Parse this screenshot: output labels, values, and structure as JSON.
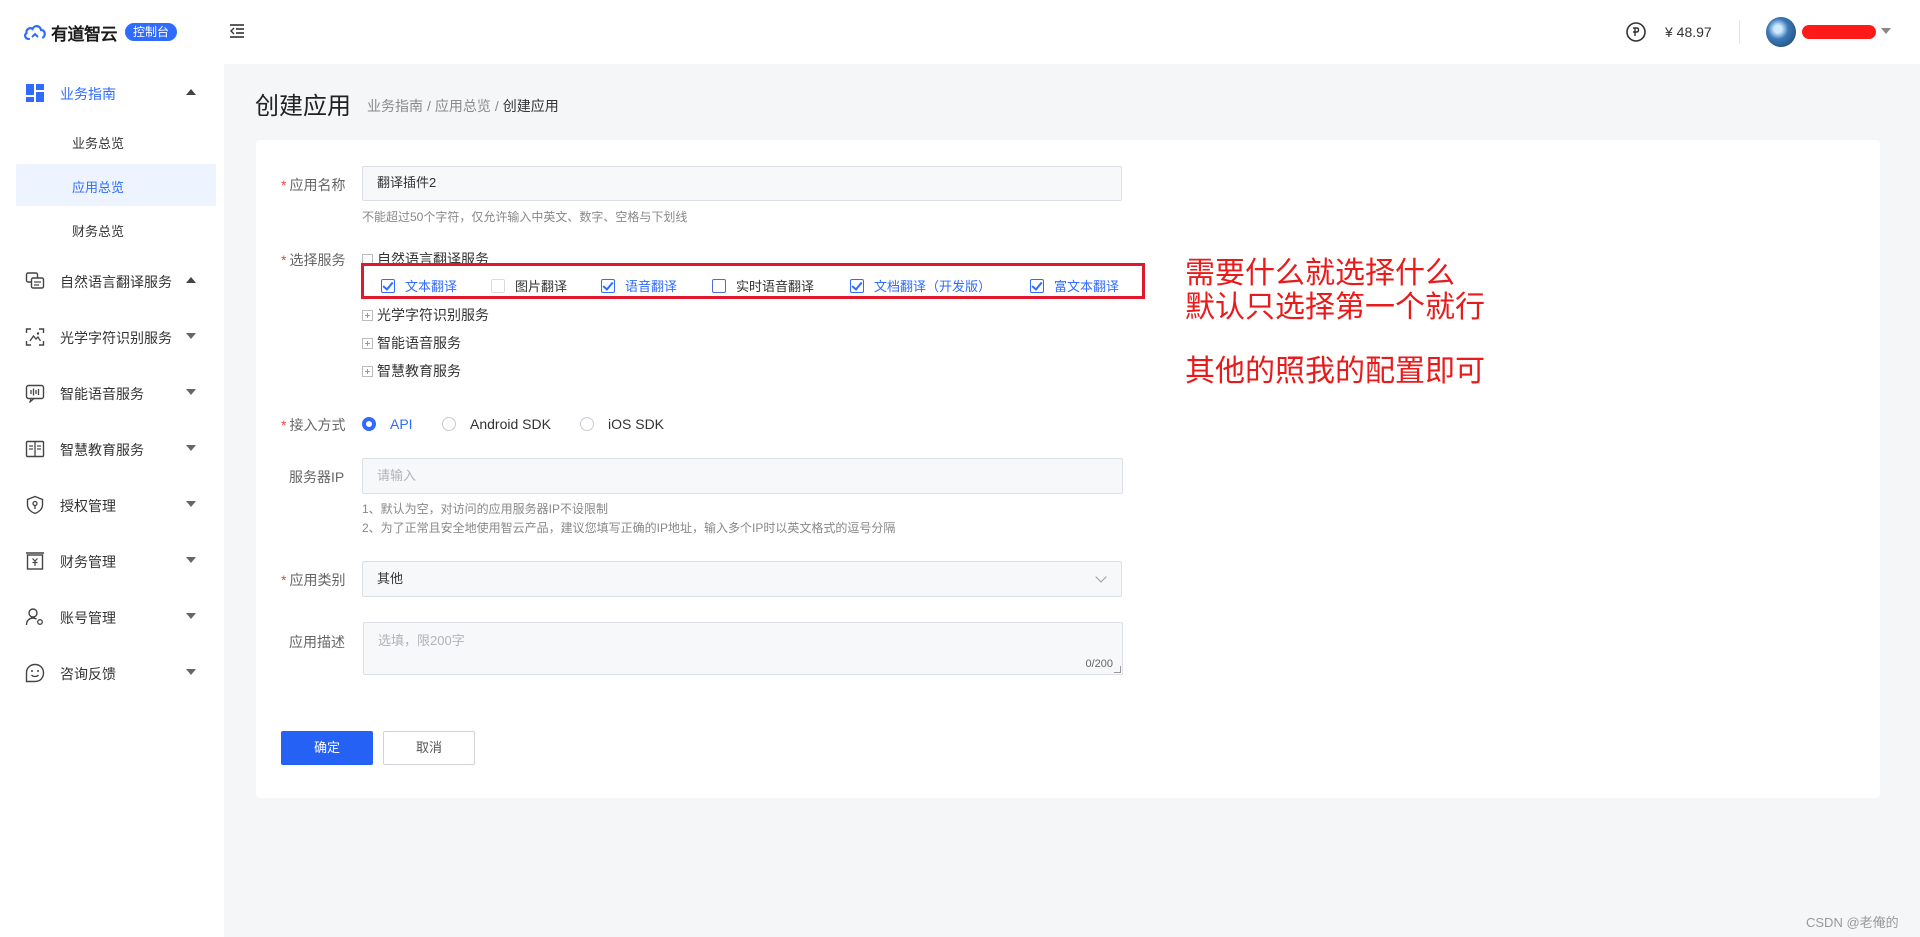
{
  "header": {
    "logo_text": "有道智云",
    "logo_badge": "控制台",
    "balance": "¥ 48.97"
  },
  "sidebar": {
    "groups": [
      {
        "label": "业务指南",
        "icon": "dashboard-icon",
        "expanded": true
      },
      {
        "label": "自然语言翻译服务",
        "icon": "translate-chat-icon",
        "expanded": true
      },
      {
        "label": "光学字符识别服务",
        "icon": "ocr-scan-icon",
        "expanded": false
      },
      {
        "label": "智能语音服务",
        "icon": "voice-wave-icon",
        "expanded": false
      },
      {
        "label": "智慧教育服务",
        "icon": "book-icon",
        "expanded": false
      },
      {
        "label": "授权管理",
        "icon": "shield-key-icon",
        "expanded": false
      },
      {
        "label": "财务管理",
        "icon": "finance-icon",
        "expanded": false
      },
      {
        "label": "账号管理",
        "icon": "account-icon",
        "expanded": false
      },
      {
        "label": "咨询反馈",
        "icon": "feedback-smile-icon",
        "expanded": false
      }
    ],
    "sub_items": [
      "业务总览",
      "应用总览",
      "财务总览"
    ],
    "active_sub": "应用总览"
  },
  "page": {
    "title": "创建应用",
    "breadcrumb": [
      "业务指南",
      "应用总览",
      "创建应用"
    ],
    "breadcrumb_sep": "/"
  },
  "form": {
    "app_name": {
      "label": "应用名称",
      "value": "翻译插件2",
      "hint": "不能超过50个字符，仅允许输入中英文、数字、空格与下划线"
    },
    "services": {
      "label": "选择服务",
      "nlp_group": "自然语言翻译服务",
      "options": [
        {
          "label": "文本翻译",
          "checked": true
        },
        {
          "label": "图片翻译",
          "checked": false
        },
        {
          "label": "语音翻译",
          "checked": true
        },
        {
          "label": "实时语音翻译",
          "checked": false
        },
        {
          "label": "文档翻译（开发版）",
          "checked": true
        },
        {
          "label": "富文本翻译",
          "checked": true
        }
      ],
      "other_groups": [
        "光学字符识别服务",
        "智能语音服务",
        "智慧教育服务"
      ]
    },
    "access": {
      "label": "接入方式",
      "options": [
        "API",
        "Android SDK",
        "iOS SDK"
      ],
      "selected": "API"
    },
    "server_ip": {
      "label": "服务器IP",
      "placeholder": "请输入",
      "hints": [
        "1、默认为空，对访问的应用服务器IP不设限制",
        "2、为了正常且安全地使用智云产品，建议您填写正确的IP地址，输入多个IP时以英文格式的逗号分隔"
      ]
    },
    "category": {
      "label": "应用类别",
      "value": "其他"
    },
    "description": {
      "label": "应用描述",
      "placeholder": "选填，限200字",
      "counter": "0/200"
    },
    "confirm_label": "确定",
    "cancel_label": "取消"
  },
  "annotation": {
    "line1": "需要什么就选择什么",
    "line2": "默认只选择第一个就行",
    "line3": "其他的照我的配置即可"
  },
  "watermark": "CSDN @老俺的",
  "colors": {
    "accent": "#2f6bff",
    "annotation_red": "#e81a1a",
    "page_bg": "#f5f6f8"
  }
}
